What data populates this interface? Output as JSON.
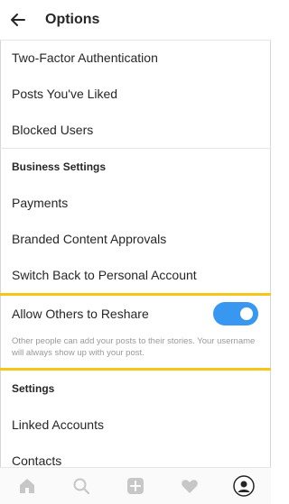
{
  "header": {
    "title": "Options"
  },
  "top_items": [
    {
      "label": "Two-Factor Authentication"
    },
    {
      "label": "Posts You've Liked"
    },
    {
      "label": "Blocked Users"
    }
  ],
  "business": {
    "header": "Business Settings",
    "items": [
      {
        "label": "Payments"
      },
      {
        "label": "Branded Content Approvals"
      },
      {
        "label": "Switch Back to Personal Account"
      }
    ]
  },
  "reshare": {
    "label": "Allow Others to Reshare",
    "enabled": true,
    "help": "Other people can add your posts to their stories. Your username will always show up with your post."
  },
  "settings": {
    "header": "Settings",
    "items": [
      {
        "label": "Linked Accounts"
      },
      {
        "label": "Contacts"
      }
    ]
  },
  "tabbar": {
    "icons": [
      "home-icon",
      "search-icon",
      "add-post-icon",
      "heart-icon",
      "profile-avatar-icon"
    ]
  },
  "colors": {
    "accent": "#3897f0",
    "highlight": "#f5c518",
    "muted": "#999999"
  }
}
